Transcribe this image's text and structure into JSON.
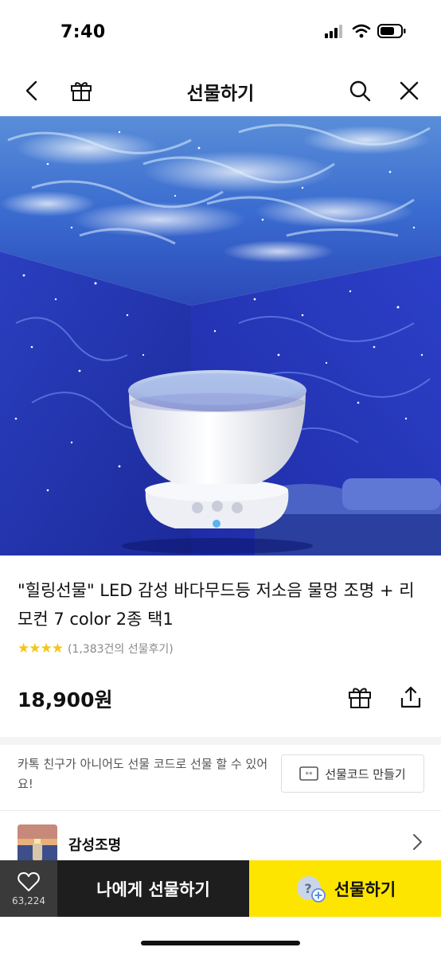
{
  "status_bar": {
    "time": "7:40"
  },
  "header": {
    "title": "선물하기",
    "icons": {
      "back": "chevron-left-icon",
      "gift": "gift-icon",
      "search": "search-icon",
      "close": "close-icon"
    }
  },
  "hero": {
    "image": "ocean wave projector night light"
  },
  "product": {
    "title": "\"힐링선물\" LED 감성 바다무드등 저소음 물멍 조명 + 리모컨 7 color 2종 택1",
    "stars": "★★★★",
    "review_text": "(1,383건의 선물후기)",
    "price": "18,900원"
  },
  "gift_code": {
    "description": "카톡 친구가 아니어도 선물 코드로 선물 할 수 있어요!",
    "button_label": "선물코드 만들기"
  },
  "category": {
    "label": "감성조명"
  },
  "bottom_bar": {
    "wish_count": "63,224",
    "gift_self_label": "나에게 선물하기",
    "gift_label": "선물하기"
  },
  "colors": {
    "accent": "#fee500",
    "star": "#f5c518",
    "dark_button": "#1e1e1e",
    "wish_bg": "#3a3a3a"
  }
}
